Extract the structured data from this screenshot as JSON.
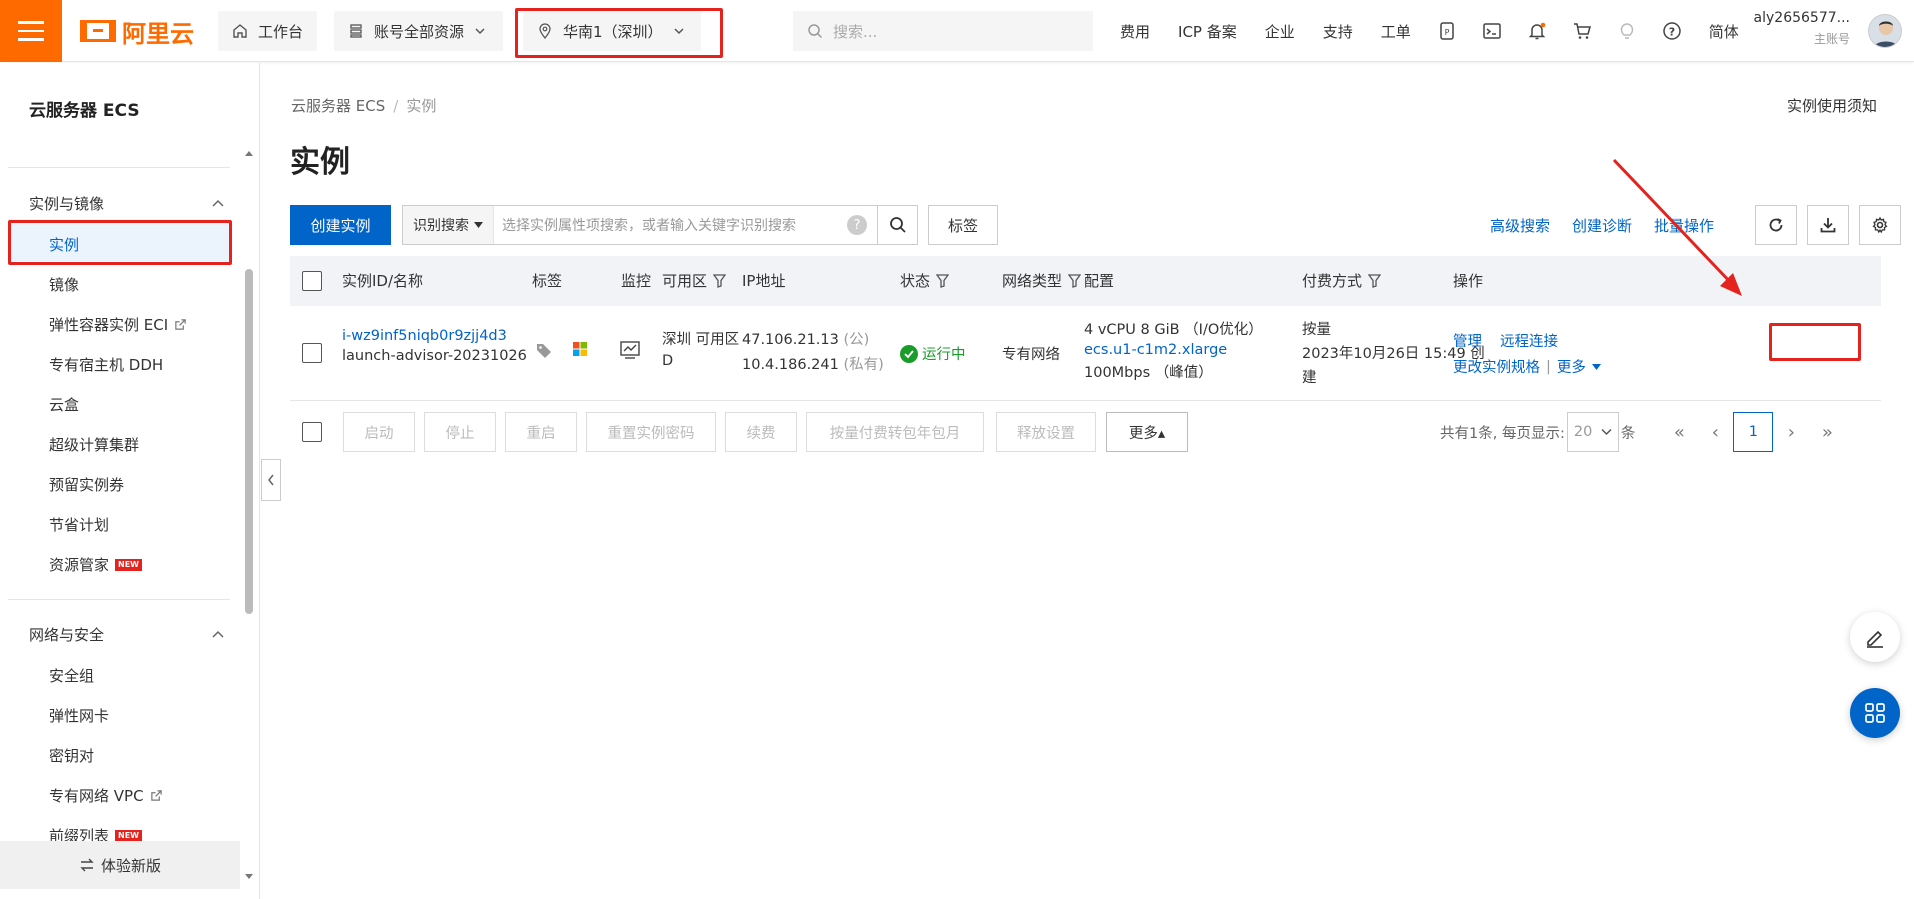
{
  "topbar": {
    "logo_text": "阿里云",
    "workbench_label": "工作台",
    "resources_label": "账号全部资源",
    "region_label": "华南1（深圳）",
    "search_placeholder": "搜索...",
    "links": [
      "费用",
      "ICP 备案",
      "企业",
      "支持",
      "工单"
    ],
    "lang_label": "简体",
    "account_name": "aly2656577...",
    "account_role": "主账号"
  },
  "sidebar": {
    "title": "云服务器 ECS",
    "groups": [
      {
        "label": "实例与镜像",
        "items": [
          {
            "label": "实例"
          },
          {
            "label": "镜像"
          },
          {
            "label": "弹性容器实例 ECI"
          },
          {
            "label": "专有宿主机 DDH"
          },
          {
            "label": "云盒"
          },
          {
            "label": "超级计算集群"
          },
          {
            "label": "预留实例券"
          },
          {
            "label": "节省计划"
          },
          {
            "label": "资源管家"
          }
        ]
      },
      {
        "label": "网络与安全",
        "items": [
          {
            "label": "安全组"
          },
          {
            "label": "弹性网卡"
          },
          {
            "label": "密钥对"
          },
          {
            "label": "专有网络 VPC"
          },
          {
            "label": "前缀列表"
          }
        ]
      }
    ],
    "new_badge": "NEW",
    "footer_label": "体验新版"
  },
  "main": {
    "breadcrumb": [
      "云服务器 ECS",
      "实例"
    ],
    "usage_notice": "实例使用须知",
    "title": "实例",
    "create_button": "创建实例",
    "search_type": "识别搜索",
    "search_placeholder": "选择实例属性项搜索，或者输入关键字识别搜索",
    "tag_button": "标签",
    "right_links": [
      "高级搜索",
      "创建诊断",
      "批量操作"
    ],
    "columns": [
      "实例ID/名称",
      "标签",
      "监控",
      "可用区",
      "IP地址",
      "状态",
      "网络类型",
      "配置",
      "付费方式",
      "操作"
    ],
    "rows": [
      {
        "instance_id": "i-wz9inf5niqb0r9zjj4d3",
        "instance_name": "launch-advisor-20231026",
        "zone_line1": "深圳 可用区",
        "zone_line2": "D",
        "ip_public": "47.106.21.13",
        "ip_public_tag": "(公)",
        "ip_private": "10.4.186.241",
        "ip_private_tag": "(私有)",
        "status": "运行中",
        "network": "专有网络",
        "config_line1": "4 vCPU 8 GiB （I/O优化）",
        "config_type": "ecs.u1-c1m2.xlarge",
        "config_bandwidth": "100Mbps （峰值）",
        "pay_type": "按量",
        "created_line1": "2023年10月26日 15:49 创",
        "created_line2": "建",
        "actions": {
          "manage": "管理",
          "remote": "远程连接",
          "change_spec": "更改实例规格",
          "more": "更多"
        }
      }
    ],
    "bulk_actions": [
      "启动",
      "停止",
      "重启",
      "重置实例密码",
      "续费",
      "按量付费转包年包月",
      "释放设置",
      "更多▴"
    ],
    "pager": {
      "summary": "共有1条, 每页显示:",
      "page_size": "20",
      "unit": "条",
      "current_page": "1"
    }
  },
  "colors": {
    "brand_orange": "#ff6a00",
    "link_blue": "#0064c8",
    "highlight_red": "#e4231e",
    "status_green": "#1a9c2b"
  }
}
